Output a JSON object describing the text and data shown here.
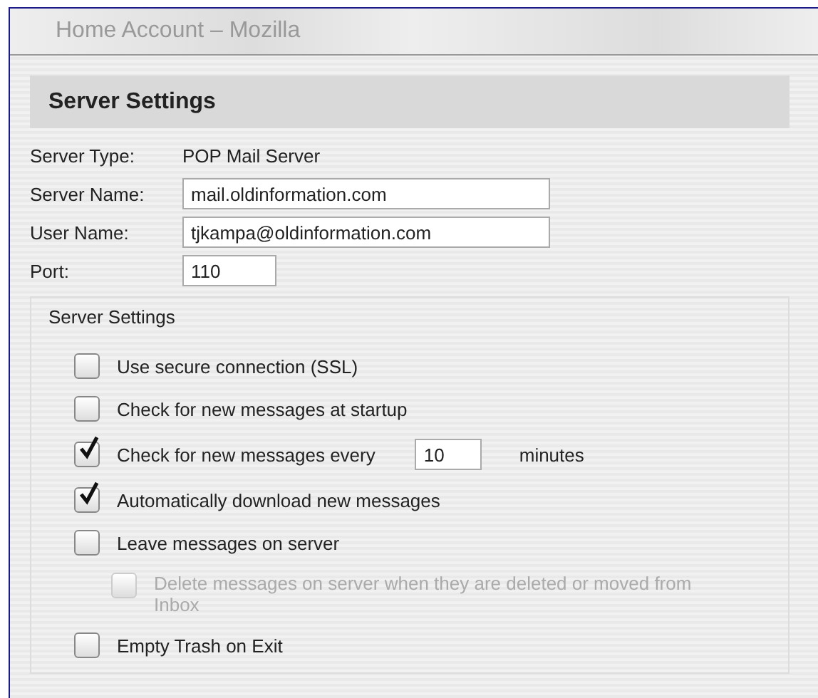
{
  "window": {
    "title": "Home Account – Mozilla"
  },
  "header": {
    "title": "Server Settings"
  },
  "fields": [
    {
      "kind": "text",
      "label": "Server Type:",
      "value": "POP Mail Server"
    },
    {
      "kind": "input",
      "label": "Server Name:",
      "value": "mail.oldinformation.com"
    },
    {
      "kind": "input",
      "label": "User Name:",
      "value": "tjkampa@oldinformation.com"
    },
    {
      "kind": "short-input",
      "label": "Port:",
      "value": "110"
    }
  ],
  "group": {
    "title": "Server Settings",
    "options": [
      {
        "kind": "checkbox",
        "label": "Use secure connection (SSL)",
        "checked": false,
        "disabled": false
      },
      {
        "kind": "checkbox",
        "label": "Check for new messages at startup",
        "checked": false,
        "disabled": false
      },
      {
        "kind": "interval",
        "label": "Check for new messages every",
        "value": "10",
        "suffix": "minutes",
        "checked": true,
        "disabled": false
      },
      {
        "kind": "checkbox",
        "label": "Automatically download new messages",
        "checked": true,
        "disabled": false
      },
      {
        "kind": "checkbox",
        "label": "Leave messages on server",
        "checked": false,
        "disabled": false,
        "children": [
          {
            "kind": "checkbox",
            "label": "Delete messages on server when they are deleted or moved from Inbox",
            "checked": false,
            "disabled": true
          }
        ]
      },
      {
        "kind": "checkbox",
        "label": "Empty Trash on Exit",
        "checked": false,
        "disabled": false
      }
    ]
  }
}
